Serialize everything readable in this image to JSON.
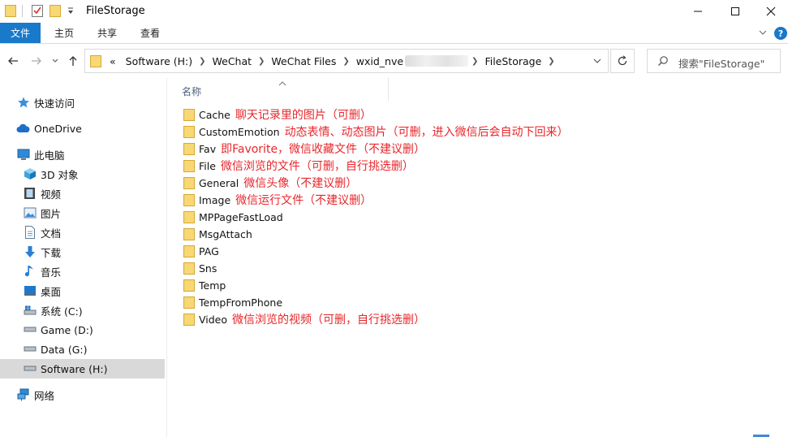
{
  "window": {
    "title": "FileStorage",
    "controls": {
      "minimize": "—",
      "maximize": "☐",
      "close": "✕"
    }
  },
  "ribbon": {
    "file_tab": "文件",
    "tabs": [
      "主页",
      "共享",
      "查看"
    ],
    "help": "?"
  },
  "address": {
    "overflow": "«",
    "crumbs": [
      "Software (H:)",
      "WeChat",
      "WeChat Files",
      "wxid_nve",
      "FileStorage"
    ]
  },
  "search": {
    "placeholder": "搜索\"FileStorage\""
  },
  "sidebar": {
    "items": [
      {
        "label": "快速访问",
        "icon": "star-icon"
      },
      {
        "label": "OneDrive",
        "icon": "cloud-icon"
      },
      {
        "label": "此电脑",
        "icon": "computer-icon"
      },
      {
        "label": "3D 对象",
        "icon": "cube-icon"
      },
      {
        "label": "视频",
        "icon": "video-icon"
      },
      {
        "label": "图片",
        "icon": "picture-icon"
      },
      {
        "label": "文档",
        "icon": "document-icon"
      },
      {
        "label": "下载",
        "icon": "download-icon"
      },
      {
        "label": "音乐",
        "icon": "music-icon"
      },
      {
        "label": "桌面",
        "icon": "desktop-icon"
      },
      {
        "label": "系统 (C:)",
        "icon": "drive-icon"
      },
      {
        "label": "Game (D:)",
        "icon": "drive-icon"
      },
      {
        "label": "Data (G:)",
        "icon": "drive-icon"
      },
      {
        "label": "Software (H:)",
        "icon": "drive-icon"
      },
      {
        "label": "网络",
        "icon": "network-icon"
      }
    ]
  },
  "list": {
    "column_name": "名称",
    "rows": [
      {
        "name": "Cache",
        "note": "聊天记录里的图片（可删）"
      },
      {
        "name": "CustomEmotion",
        "note": "动态表情、动态图片（可删，进入微信后会自动下回来）"
      },
      {
        "name": "Fav",
        "note": "即Favorite，微信收藏文件（不建议删）"
      },
      {
        "name": "File",
        "note": "微信浏览的文件（可删，自行挑选删）"
      },
      {
        "name": "General",
        "note": "微信头像（不建议删）"
      },
      {
        "name": "Image",
        "note": "微信运行文件（不建议删）"
      },
      {
        "name": "MPPageFastLoad",
        "note": ""
      },
      {
        "name": "MsgAttach",
        "note": ""
      },
      {
        "name": "PAG",
        "note": ""
      },
      {
        "name": "Sns",
        "note": ""
      },
      {
        "name": "Temp",
        "note": ""
      },
      {
        "name": "TempFromPhone",
        "note": ""
      },
      {
        "name": "Video",
        "note": "微信浏览的视频（可删，自行挑选删）"
      }
    ]
  },
  "colors": {
    "accent": "#1979ca",
    "annotation": "#e8262b",
    "folder": "#f8d775",
    "selection": "#d9d9d9"
  }
}
